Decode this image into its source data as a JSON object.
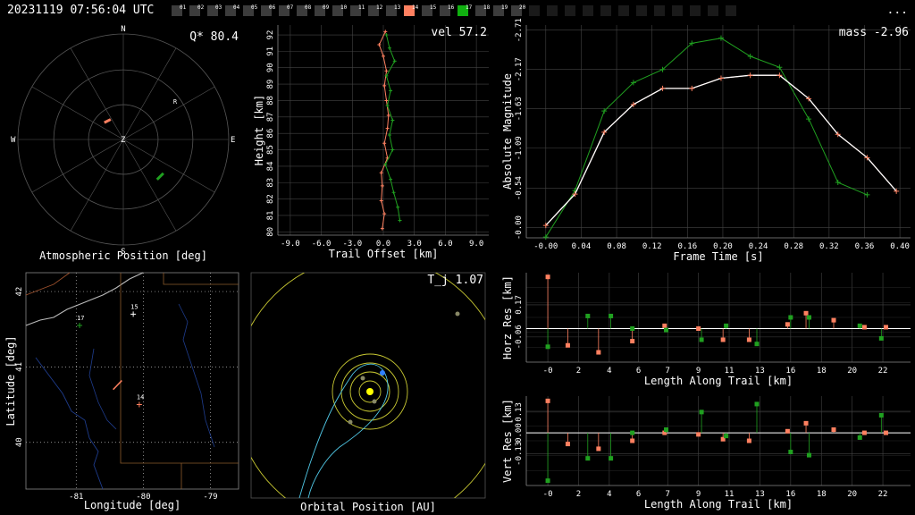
{
  "header": {
    "timestamp": "20231119 07:56:04 UTC",
    "menu_label": "...",
    "stations": [
      {
        "n": 1,
        "label": "01",
        "state": "off"
      },
      {
        "n": 2,
        "label": "02",
        "state": "off"
      },
      {
        "n": 3,
        "label": "03",
        "state": "off"
      },
      {
        "n": 4,
        "label": "04",
        "state": "off"
      },
      {
        "n": 5,
        "label": "05",
        "state": "off"
      },
      {
        "n": 6,
        "label": "06",
        "state": "off"
      },
      {
        "n": 7,
        "label": "07",
        "state": "off"
      },
      {
        "n": 8,
        "label": "08",
        "state": "off"
      },
      {
        "n": 9,
        "label": "09",
        "state": "off"
      },
      {
        "n": 10,
        "label": "10",
        "state": "off"
      },
      {
        "n": 11,
        "label": "11",
        "state": "off"
      },
      {
        "n": 12,
        "label": "12",
        "state": "off"
      },
      {
        "n": 13,
        "label": "13",
        "state": "off"
      },
      {
        "n": 14,
        "label": "14",
        "state": "orange"
      },
      {
        "n": 15,
        "label": "15",
        "state": "off"
      },
      {
        "n": 16,
        "label": "16",
        "state": "off"
      },
      {
        "n": 17,
        "label": "17",
        "state": "green"
      },
      {
        "n": 18,
        "label": "18",
        "state": "off"
      },
      {
        "n": 19,
        "label": "19",
        "state": "off"
      },
      {
        "n": 20,
        "label": "20",
        "state": "off"
      },
      {
        "n": 21,
        "label": "",
        "state": "empty"
      },
      {
        "n": 22,
        "label": "",
        "state": "empty"
      },
      {
        "n": 23,
        "label": "",
        "state": "empty"
      },
      {
        "n": 24,
        "label": "",
        "state": "empty"
      },
      {
        "n": 25,
        "label": "",
        "state": "empty"
      },
      {
        "n": 26,
        "label": "",
        "state": "empty"
      },
      {
        "n": 27,
        "label": "",
        "state": "empty"
      },
      {
        "n": 28,
        "label": "",
        "state": "empty"
      },
      {
        "n": 29,
        "label": "",
        "state": "empty"
      },
      {
        "n": 30,
        "label": "",
        "state": "empty"
      },
      {
        "n": 31,
        "label": "",
        "state": "empty"
      },
      {
        "n": 32,
        "label": "",
        "state": "empty"
      }
    ]
  },
  "colors": {
    "orange": "#ff8060",
    "green": "#20a020",
    "grid": "#444444",
    "yellow": "#c8c832",
    "cyan": "#50c8e6",
    "white": "#ffffff"
  },
  "chart_data": [
    {
      "id": "atmos",
      "type": "scatter",
      "xlabel": "Atmospheric Position [deg]",
      "annotation": "Q* 80.4",
      "directions": {
        "n": "N",
        "s": "S",
        "e": "E",
        "w": "W",
        "center": "Z",
        "marker": "R"
      },
      "series": [
        {
          "color": "orange",
          "points": [
            [
              -0.18,
              0.16
            ],
            [
              -0.12,
              0.19
            ]
          ]
        },
        {
          "color": "green",
          "points": [
            [
              0.32,
              -0.38
            ],
            [
              0.38,
              -0.32
            ]
          ]
        }
      ]
    },
    {
      "id": "height",
      "type": "line",
      "xlabel": "Trail Offset [km]",
      "ylabel": "Height [km]",
      "annotation": "vel 57.2",
      "xlim": [
        -10.2,
        10.2
      ],
      "ylim": [
        79.8,
        92.6
      ],
      "xticks": [
        "-9.0",
        "-6.0",
        "-3.0",
        "0.0",
        "3.0",
        "6.0",
        "9.0"
      ],
      "xtick_values": [
        -9,
        -6,
        -3,
        0,
        3,
        6,
        9
      ],
      "yticks": [
        "80",
        "81",
        "82",
        "83",
        "84",
        "85",
        "86",
        "87",
        "88",
        "89",
        "90",
        "91",
        "92"
      ],
      "ytick_values": [
        80,
        81,
        82,
        83,
        84,
        85,
        86,
        87,
        88,
        89,
        90,
        91,
        92
      ],
      "series": [
        {
          "color": "orange",
          "points": [
            [
              0.2,
              92.2
            ],
            [
              -0.4,
              91.4
            ],
            [
              0.0,
              90.7
            ],
            [
              0.3,
              89.8
            ],
            [
              0.1,
              88.9
            ],
            [
              0.3,
              88.0
            ],
            [
              0.5,
              87.1
            ],
            [
              0.4,
              86.3
            ],
            [
              0.1,
              85.4
            ],
            [
              0.4,
              84.5
            ],
            [
              -0.2,
              83.6
            ],
            [
              -0.1,
              82.8
            ],
            [
              -0.2,
              81.9
            ],
            [
              0.1,
              81.1
            ],
            [
              -0.1,
              80.2
            ]
          ]
        },
        {
          "color": "green",
          "points": [
            [
              0.3,
              92.0
            ],
            [
              0.6,
              91.2
            ],
            [
              1.1,
              90.4
            ],
            [
              0.3,
              89.5
            ],
            [
              0.7,
              88.6
            ],
            [
              0.4,
              87.7
            ],
            [
              0.9,
              86.8
            ],
            [
              0.6,
              85.9
            ],
            [
              0.9,
              85.0
            ],
            [
              0.2,
              84.1
            ],
            [
              0.7,
              83.2
            ],
            [
              1.0,
              82.4
            ],
            [
              1.4,
              81.5
            ],
            [
              1.6,
              80.7
            ]
          ]
        }
      ]
    },
    {
      "id": "mag",
      "type": "line",
      "xlabel": "Frame Time [s]",
      "ylabel": "Absolute Magnitude",
      "annotation": "mass -2.96",
      "xlim": [
        -0.022,
        0.412
      ],
      "ylim": [
        -2.78,
        0.14
      ],
      "yreversed": true,
      "xticks": [
        "-0.00",
        "0.04",
        "0.08",
        "0.12",
        "0.16",
        "0.20",
        "0.24",
        "0.28",
        "0.32",
        "0.36",
        "0.40"
      ],
      "xtick_values": [
        0.0,
        0.04,
        0.08,
        0.12,
        0.16,
        0.2,
        0.24,
        0.28,
        0.32,
        0.36,
        0.4
      ],
      "yticks": [
        "-0.00",
        "-0.54",
        "-1.09",
        "-1.63",
        "-2.17",
        "-2.71"
      ],
      "ytick_values": [
        0.0,
        -0.54,
        -1.09,
        -1.63,
        -2.17,
        -2.71
      ],
      "series": [
        {
          "color": "orange",
          "points": [
            [
              0.0,
              -0.03
            ],
            [
              0.033,
              -0.46
            ],
            [
              0.066,
              -1.31
            ],
            [
              0.099,
              -1.69
            ],
            [
              0.132,
              -1.91
            ],
            [
              0.165,
              -1.91
            ],
            [
              0.198,
              -2.05
            ],
            [
              0.231,
              -2.09
            ],
            [
              0.264,
              -2.09
            ],
            [
              0.297,
              -1.77
            ],
            [
              0.33,
              -1.28
            ],
            [
              0.363,
              -0.96
            ],
            [
              0.396,
              -0.5
            ]
          ]
        },
        {
          "color": "green",
          "points": [
            [
              0.0,
              0.13
            ],
            [
              0.033,
              -0.51
            ],
            [
              0.066,
              -1.6
            ],
            [
              0.099,
              -1.99
            ],
            [
              0.132,
              -2.17
            ],
            [
              0.165,
              -2.53
            ],
            [
              0.198,
              -2.6
            ],
            [
              0.231,
              -2.35
            ],
            [
              0.264,
              -2.2
            ],
            [
              0.297,
              -1.49
            ],
            [
              0.33,
              -0.62
            ],
            [
              0.363,
              -0.45
            ]
          ]
        }
      ]
    },
    {
      "id": "latlon",
      "type": "scatter",
      "xlabel": "Longitude [deg]",
      "ylabel": "Latitude [deg]",
      "xlim": [
        -81.75,
        -78.58
      ],
      "ylim": [
        39.38,
        42.25
      ],
      "xticks": [
        "-81",
        "-80",
        "-79"
      ],
      "xtick_values": [
        -81,
        -80,
        -79
      ],
      "yticks": [
        "40",
        "41",
        "42"
      ],
      "ytick_values": [
        40,
        41,
        42
      ],
      "stations": [
        {
          "label": "17",
          "lon": -80.95,
          "lat": 41.55,
          "color": "green"
        },
        {
          "label": "15",
          "lon": -80.15,
          "lat": 41.7,
          "color": "white"
        },
        {
          "label": "14",
          "lon": -80.06,
          "lat": 40.5,
          "color": "orange"
        }
      ],
      "trail": [
        [
          -80.45,
          40.7
        ],
        [
          -80.32,
          40.82
        ]
      ]
    },
    {
      "id": "orbit",
      "type": "scatter",
      "xlabel": "Orbital Position [AU]",
      "annotation": "T_j 1.07"
    },
    {
      "id": "horz",
      "type": "scatter",
      "xlabel": "Length Along Trail [km]",
      "ylabel": "Horz Res [km]",
      "xlim": [
        -1.4,
        23.6
      ],
      "ylim": [
        -0.24,
        0.4
      ],
      "xticks": [
        "-0",
        "2",
        "4",
        "6",
        "7",
        "9",
        "11",
        "13",
        "16",
        "18",
        "20",
        "22"
      ],
      "xtick_values": [
        0.0,
        2.0,
        4.0,
        5.9,
        7.8,
        9.8,
        11.8,
        13.8,
        15.8,
        17.8,
        19.8,
        21.8
      ],
      "yticks": [
        "-0.06",
        "0.17"
      ],
      "ytick_values": [
        -0.06,
        0.17
      ],
      "series": [
        {
          "color": "orange",
          "points": [
            [
              0.0,
              0.37
            ],
            [
              1.3,
              -0.12
            ],
            [
              3.3,
              -0.17
            ],
            [
              5.5,
              -0.09
            ],
            [
              7.6,
              0.02
            ],
            [
              9.8,
              0.0
            ],
            [
              11.4,
              -0.08
            ],
            [
              13.1,
              -0.08
            ],
            [
              15.6,
              0.03
            ],
            [
              16.8,
              0.11
            ],
            [
              18.6,
              0.06
            ],
            [
              20.6,
              0.01
            ],
            [
              22.0,
              0.01
            ]
          ]
        },
        {
          "color": "green",
          "points": [
            [
              0.0,
              -0.13
            ],
            [
              2.6,
              0.09
            ],
            [
              4.1,
              0.09
            ],
            [
              5.5,
              0.0
            ],
            [
              7.7,
              -0.01
            ],
            [
              10.0,
              -0.08
            ],
            [
              11.6,
              0.02
            ],
            [
              13.6,
              -0.11
            ],
            [
              15.8,
              0.08
            ],
            [
              17.0,
              0.08
            ],
            [
              20.3,
              0.02
            ],
            [
              21.7,
              -0.07
            ]
          ]
        }
      ]
    },
    {
      "id": "vert",
      "type": "scatter",
      "xlabel": "Length Along Trail [km]",
      "ylabel": "Vert Res [km]",
      "xlim": [
        -1.4,
        23.6
      ],
      "ylim": [
        -0.33,
        0.23
      ],
      "xticks": [
        "-0",
        "2",
        "4",
        "6",
        "7",
        "9",
        "11",
        "13",
        "16",
        "18",
        "20",
        "22"
      ],
      "xtick_values": [
        0.0,
        2.0,
        4.0,
        5.9,
        7.8,
        9.8,
        11.8,
        13.8,
        15.8,
        17.8,
        19.8,
        21.8
      ],
      "yticks": [
        "-0.13",
        "0.00",
        "0.13"
      ],
      "ytick_values": [
        -0.13,
        0.0,
        0.13
      ],
      "series": [
        {
          "color": "orange",
          "points": [
            [
              0.0,
              0.2
            ],
            [
              1.3,
              -0.07
            ],
            [
              3.3,
              -0.1
            ],
            [
              5.5,
              -0.05
            ],
            [
              7.6,
              0.0
            ],
            [
              9.8,
              -0.01
            ],
            [
              11.4,
              -0.04
            ],
            [
              13.1,
              -0.05
            ],
            [
              15.6,
              0.01
            ],
            [
              16.8,
              0.06
            ],
            [
              18.6,
              0.02
            ],
            [
              20.6,
              0.0
            ],
            [
              22.0,
              0.0
            ]
          ]
        },
        {
          "color": "green",
          "points": [
            [
              0.0,
              -0.3
            ],
            [
              2.6,
              -0.16
            ],
            [
              4.1,
              -0.16
            ],
            [
              5.5,
              0.0
            ],
            [
              7.7,
              0.02
            ],
            [
              10.0,
              0.13
            ],
            [
              11.6,
              -0.02
            ],
            [
              13.6,
              0.18
            ],
            [
              15.8,
              -0.12
            ],
            [
              17.0,
              -0.14
            ],
            [
              20.3,
              -0.03
            ],
            [
              21.7,
              0.11
            ]
          ]
        }
      ]
    }
  ]
}
